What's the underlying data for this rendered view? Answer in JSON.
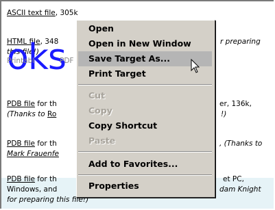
{
  "entries": [
    {
      "link": "ASCII text file",
      "text": ", 305k"
    },
    {
      "link": "HTML file",
      "text": ", 348",
      "tail": "r preparing",
      "line2": "this file!)"
    },
    {
      "prefix": "Printabl",
      "tail_mid": "PDF"
    },
    {
      "link": "PDB file",
      "text": " for th",
      "tail": "er, 136k,",
      "line2_pre": "(Thanks to ",
      "line2_link": "Ro",
      "line2_tail": "!)"
    },
    {
      "link": "PDB file",
      "text": " for th",
      "tail": ", (Thanks to",
      "line2_link": "Mark Frauenfe"
    },
    {
      "link": "PDB file",
      "text": " for th",
      "tail": "et PC,",
      "line2": "Windows, and",
      "line2_right": "dam Knight",
      "line3": "for preparing this file!)"
    }
  ],
  "overlay_text": "oks",
  "context_menu": {
    "items": [
      {
        "label": "Open",
        "state": "normal"
      },
      {
        "label": "Open in New Window",
        "state": "normal"
      },
      {
        "label": "Save Target As...",
        "state": "highlighted"
      },
      {
        "label": "Print Target",
        "state": "normal"
      },
      {
        "label": "Cut",
        "state": "disabled"
      },
      {
        "label": "Copy",
        "state": "disabled"
      },
      {
        "label": "Copy Shortcut",
        "state": "normal"
      },
      {
        "label": "Paste",
        "state": "disabled"
      },
      {
        "label": "Add to Favorites...",
        "state": "normal"
      },
      {
        "label": "Properties",
        "state": "normal"
      }
    ]
  },
  "colors": {
    "highlight": "#b5b5b5",
    "menu_bg": "#d4d0c8",
    "overlay_blue": "#1a1aff",
    "band": "#e6f3f7"
  },
  "icons": [
    "mouse-pointer-icon"
  ]
}
